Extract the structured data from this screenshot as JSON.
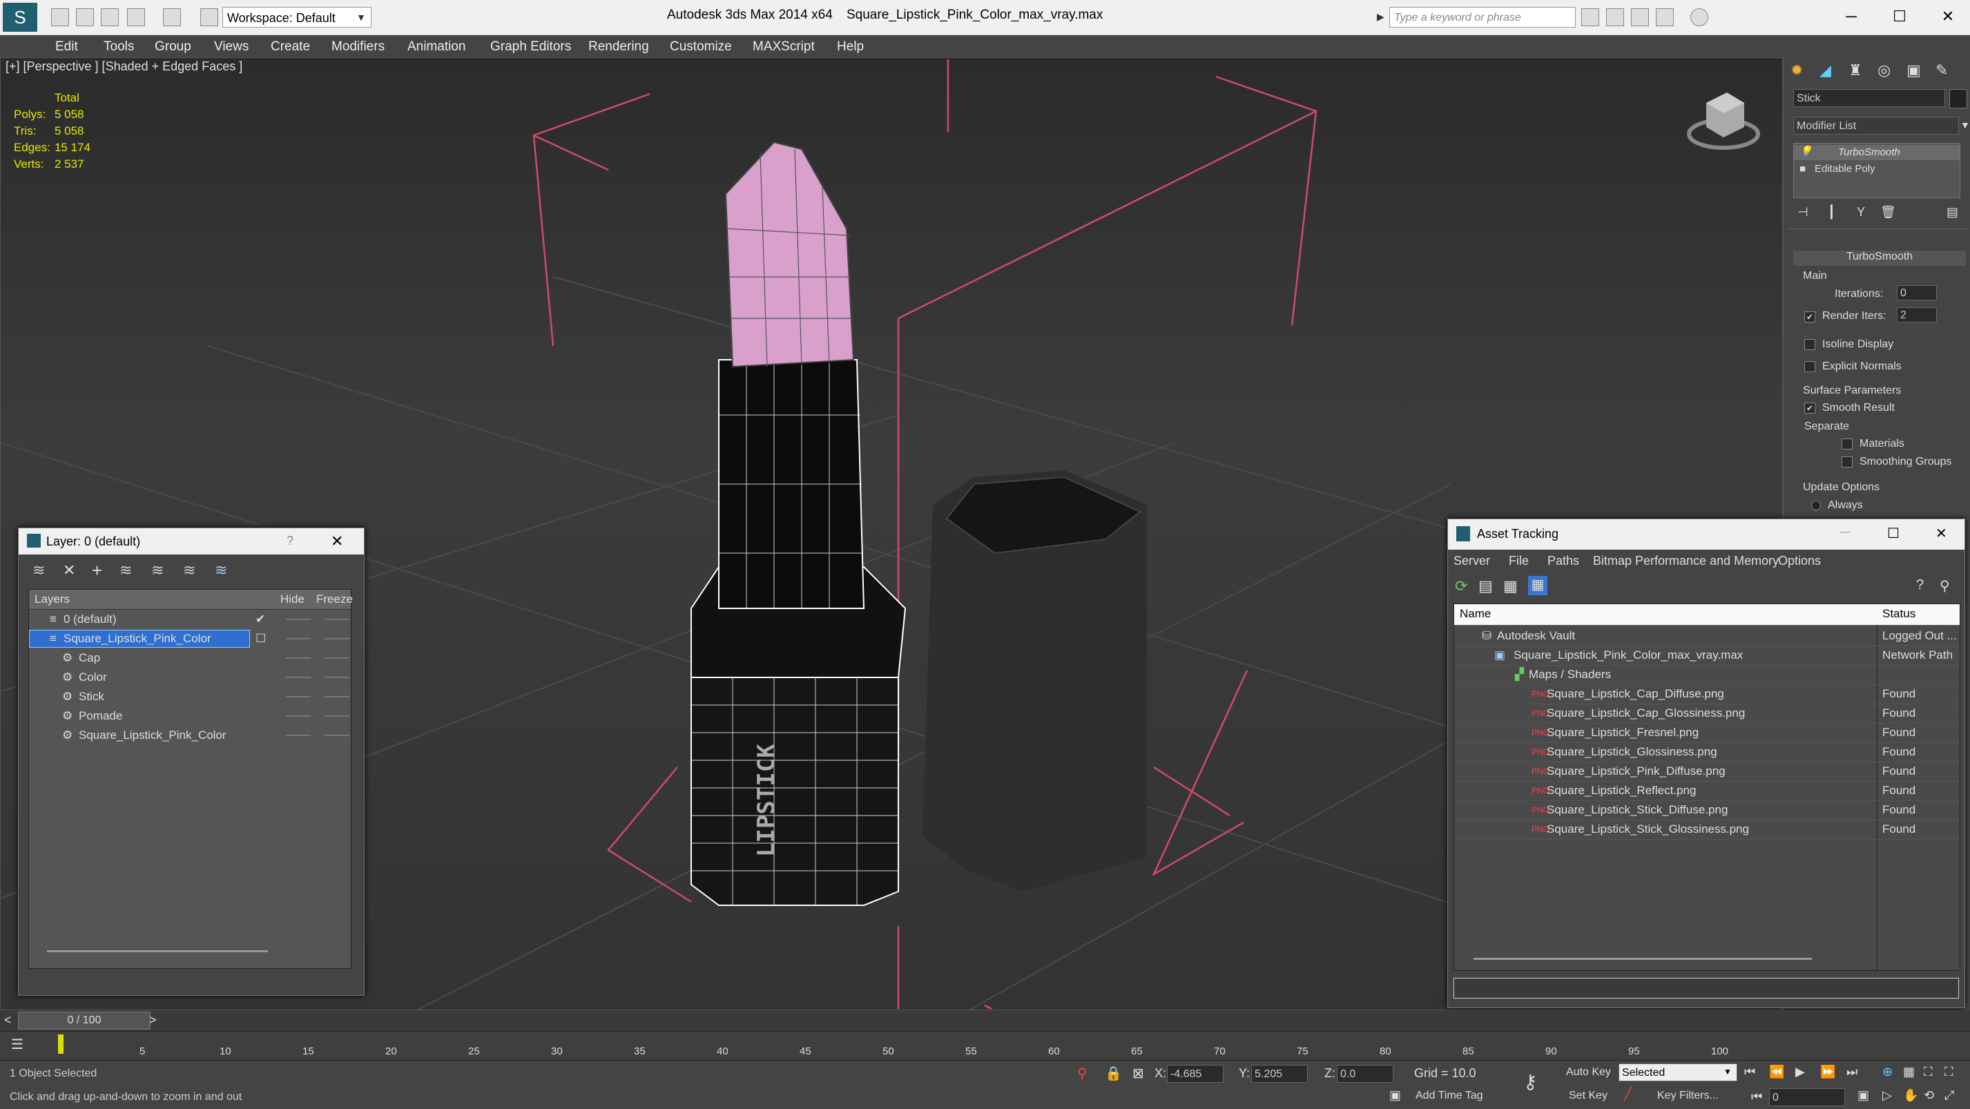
{
  "titlebar": {
    "app_title": "Autodesk 3ds Max  2014 x64",
    "file_title": "Square_Lipstick_Pink_Color_max_vray.max",
    "workspace": "Workspace: Default",
    "search_placeholder": "Type a keyword or phrase"
  },
  "menu": [
    "Edit",
    "Tools",
    "Group",
    "Views",
    "Create",
    "Modifiers",
    "Animation",
    "Graph Editors",
    "Rendering",
    "Customize",
    "MAXScript",
    "Help"
  ],
  "viewport": {
    "label": "[+] [Perspective ] [Shaded + Edged Faces ]",
    "stats": {
      "header": "Total",
      "rows": [
        {
          "label": "Polys:",
          "value": "5 058"
        },
        {
          "label": "Tris:",
          "value": "5 058"
        },
        {
          "label": "Edges:",
          "value": "15 174"
        },
        {
          "label": "Verts:",
          "value": "2 537"
        }
      ]
    },
    "engraving": "LIPSTICK"
  },
  "command_panel": {
    "object_name": "Stick",
    "modifier_list": "Modifier List",
    "stack": [
      "TurboSmooth",
      "Editable Poly"
    ],
    "rollout_title": "TurboSmooth",
    "main_label": "Main",
    "iterations_label": "Iterations:",
    "iterations_value": "0",
    "render_iters_label": "Render Iters:",
    "render_iters_value": "2",
    "isoline": "Isoline Display",
    "explicit": "Explicit Normals",
    "surface_params": "Surface Parameters",
    "smooth_result": "Smooth Result",
    "separate": "Separate",
    "materials": "Materials",
    "smoothing_groups": "Smoothing Groups",
    "update_options": "Update Options",
    "always": "Always"
  },
  "layer_explorer": {
    "title": "Layer: 0 (default)",
    "help": "?",
    "columns": {
      "layers": "Layers",
      "hide": "Hide",
      "freeze": "Freeze"
    },
    "rows": [
      "0 (default)",
      "Square_Lipstick_Pink_Color",
      "Cap",
      "Color",
      "Stick",
      "Pomade",
      "Square_Lipstick_Pink_Color"
    ]
  },
  "asset_tracking": {
    "title": "Asset Tracking",
    "menu": [
      "Server",
      "File",
      "Paths",
      "Bitmap Performance and Memory",
      "Options"
    ],
    "columns": {
      "name": "Name",
      "status": "Status"
    },
    "rows": [
      {
        "name": "Autodesk Vault",
        "status": "Logged Out ..."
      },
      {
        "name": "Square_Lipstick_Pink_Color_max_vray.max",
        "status": "Network Path"
      },
      {
        "name": "Maps / Shaders",
        "status": ""
      },
      {
        "name": "Square_Lipstick_Cap_Diffuse.png",
        "status": "Found"
      },
      {
        "name": "Square_Lipstick_Cap_Glossiness.png",
        "status": "Found"
      },
      {
        "name": "Square_Lipstick_Fresnel.png",
        "status": "Found"
      },
      {
        "name": "Square_Lipstick_Glossiness.png",
        "status": "Found"
      },
      {
        "name": "Square_Lipstick_Pink_Diffuse.png",
        "status": "Found"
      },
      {
        "name": "Square_Lipstick_Reflect.png",
        "status": "Found"
      },
      {
        "name": "Square_Lipstick_Stick_Diffuse.png",
        "status": "Found"
      },
      {
        "name": "Square_Lipstick_Stick_Glossiness.png",
        "status": "Found"
      }
    ]
  },
  "timeline": {
    "frame": "0 / 100",
    "ticks": [
      "5",
      "10",
      "15",
      "20",
      "25",
      "30",
      "35",
      "40",
      "45",
      "50",
      "55",
      "60",
      "65",
      "70",
      "75",
      "80",
      "85",
      "90",
      "95",
      "100"
    ]
  },
  "status": {
    "selection": "1 Object Selected",
    "prompt": "Click and drag up-and-down to zoom in and out",
    "x_label": "X:",
    "x_value": "-4.685",
    "y_label": "Y:",
    "y_value": "5.205",
    "z_label": "Z:",
    "z_value": "0.0",
    "grid": "Grid = 10.0",
    "add_time_tag": "Add Time Tag",
    "auto_key": "Auto Key",
    "set_key": "Set Key",
    "selected": "Selected",
    "key_filters": "Key Filters...",
    "frame_value": "0"
  }
}
